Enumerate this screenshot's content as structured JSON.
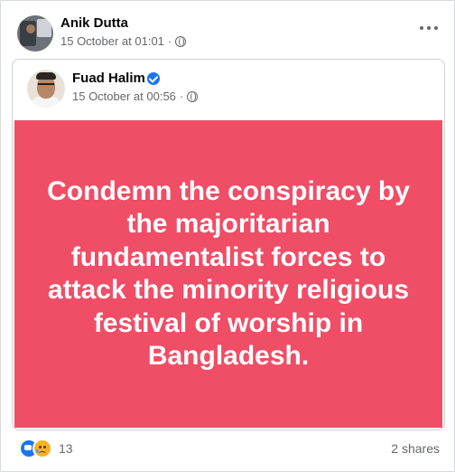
{
  "post": {
    "author": "Anik Dutta",
    "timestamp": "15 October at 01:01",
    "privacy_icon": "globe-icon",
    "menu_icon": "more-options-icon"
  },
  "shared_post": {
    "author": "Fuad Halim",
    "verified_icon": "verified-badge-icon",
    "timestamp": "15 October at 00:56",
    "privacy_icon": "globe-icon",
    "message": "Condemn the conspiracy by the majoritarian fundamentalist forces to attack the minority religious festival of worship in Bangladesh.",
    "background_color": "#f04d66"
  },
  "footer": {
    "reaction_icons": [
      "like-icon",
      "sad-icon"
    ],
    "reaction_count": "13",
    "shares": "2 shares"
  }
}
